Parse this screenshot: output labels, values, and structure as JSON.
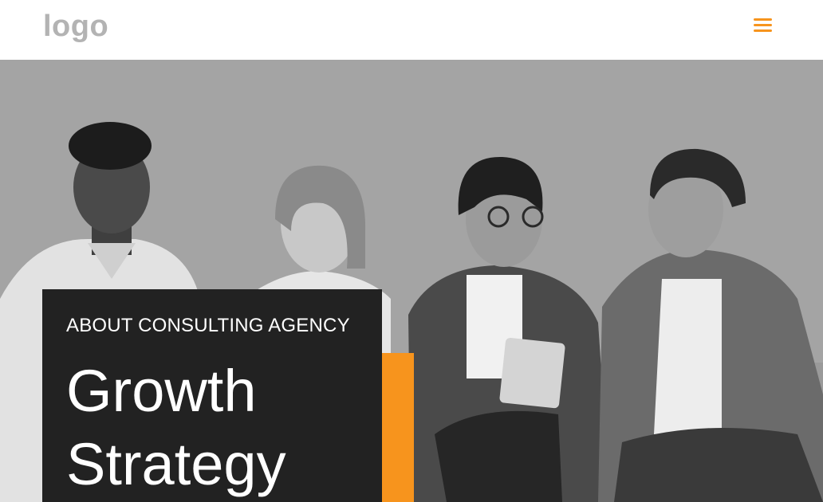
{
  "header": {
    "logo_text": "logo",
    "menu_icon": "hamburger-menu-icon"
  },
  "hero": {
    "eyebrow": "ABOUT CONSULTING AGENCY",
    "headline_line1": "Growth",
    "headline_line2": "Strategy",
    "photo_description_icon": "team-photo"
  },
  "colors": {
    "accent": "#f7941d",
    "card": "#222222",
    "logo": "#b3b3b3"
  }
}
